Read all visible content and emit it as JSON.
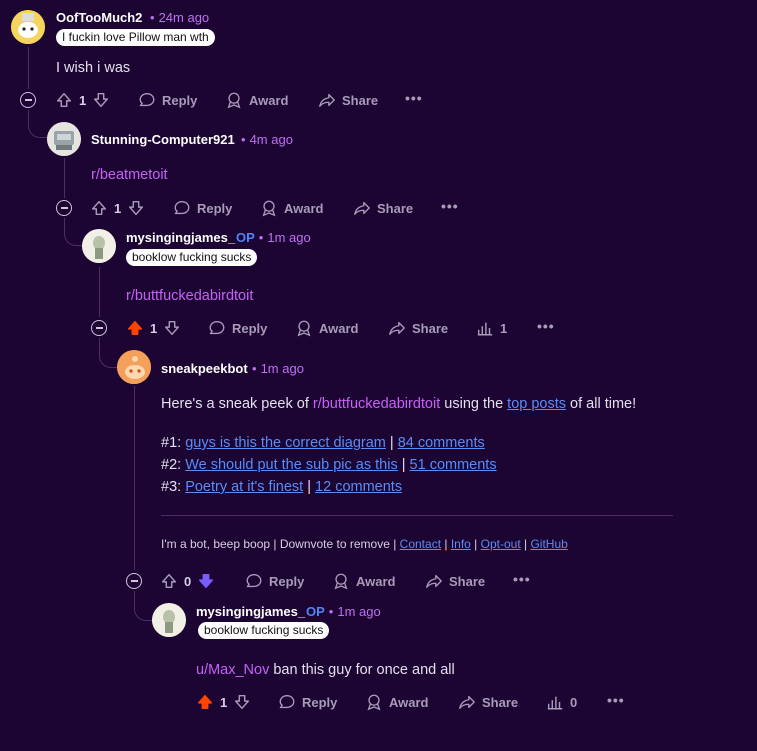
{
  "comments": [
    {
      "author": "OofTooMuch2",
      "time": "24m ago",
      "flair": "I fuckin love Pillow man wth",
      "body": "I wish i was",
      "votes": "1",
      "actions": {
        "reply": "Reply",
        "award": "Award",
        "share": "Share"
      }
    },
    {
      "author": "Stunning-Computer921",
      "time": "4m ago",
      "body": "r/beatmetoit",
      "votes": "1",
      "actions": {
        "reply": "Reply",
        "award": "Award",
        "share": "Share"
      }
    },
    {
      "author": "mysingingjames_",
      "op_badge": "OP",
      "time": "1m ago",
      "flair": "booklow fucking sucks",
      "body": "r/buttfuckedabirdtoit",
      "votes": "1",
      "upvoted": true,
      "insights": "1",
      "actions": {
        "reply": "Reply",
        "award": "Award",
        "share": "Share"
      }
    },
    {
      "author": "sneakpeekbot",
      "time": "1m ago",
      "intro_pre": "Here's a sneak peek of ",
      "intro_sub": "r/buttfuckedabirdtoit",
      "intro_mid": " using the ",
      "intro_link": "top posts",
      "intro_post": " of all time!",
      "posts": [
        {
          "rank": "#1: ",
          "title": "guys is this the correct diagram",
          "sep": " | ",
          "comments": "84 comments"
        },
        {
          "rank": "#2: ",
          "title": "We should put the sub pic as this",
          "sep": " | ",
          "comments": "51 comments"
        },
        {
          "rank": "#3: ",
          "title": "Poetry at it's finest",
          "sep": " | ",
          "comments": "12 comments"
        }
      ],
      "footer_text": "I'm a bot, beep boop | Downvote to remove | ",
      "footer_links": [
        "Contact",
        "Info",
        "Opt-out",
        "GitHub"
      ],
      "footer_sep": " | ",
      "votes": "0",
      "downvoted": true,
      "actions": {
        "reply": "Reply",
        "award": "Award",
        "share": "Share"
      }
    },
    {
      "author": "mysingingjames_",
      "op_badge": "OP",
      "time": "1m ago",
      "flair": "booklow fucking sucks",
      "body_user": "u/Max_Nov",
      "body_rest": " ban this guy for once and all",
      "votes": "1",
      "upvoted": true,
      "insights": "0",
      "actions": {
        "reply": "Reply",
        "award": "Award",
        "share": "Share"
      }
    }
  ],
  "colors": {
    "background": "#1c0433",
    "upvote": "#ff4500",
    "downvote": "#7a5cff",
    "subreddit_link": "#c762f5",
    "link": "#5a8df5"
  }
}
